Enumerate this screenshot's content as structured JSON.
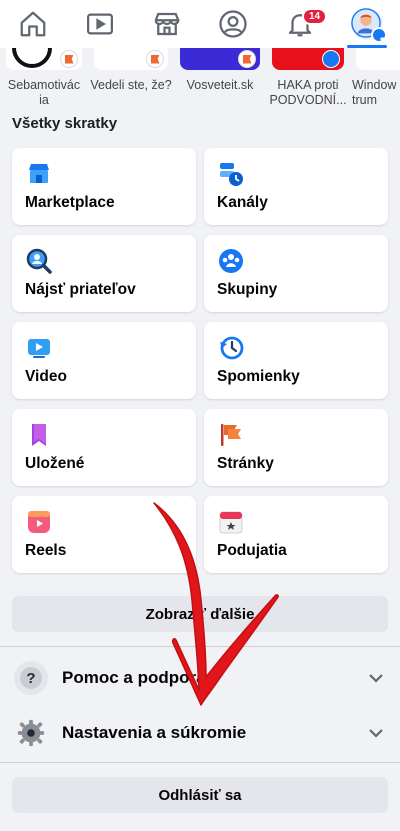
{
  "nav": {
    "items": [
      {
        "name": "home",
        "icon": "home-icon"
      },
      {
        "name": "watch",
        "icon": "video-icon"
      },
      {
        "name": "marketplace",
        "icon": "shop-icon"
      },
      {
        "name": "profile",
        "icon": "profile-icon"
      },
      {
        "name": "notifications",
        "icon": "bell-icon",
        "badge": "14"
      },
      {
        "name": "menu",
        "icon": "avatar-menu-icon",
        "active": true
      }
    ],
    "notifications_badge": "14"
  },
  "stories": [
    {
      "label": "Sebamotivác ia"
    },
    {
      "label": "Vedeli ste, že?"
    },
    {
      "label": "Vosveteit.sk"
    },
    {
      "label": "HAKA proti PODVODNÍ..."
    },
    {
      "label": "Window trum"
    }
  ],
  "shortcuts_title": "Všetky skratky",
  "shortcuts": [
    {
      "label": "Marketplace",
      "icon": "marketplace-icon"
    },
    {
      "label": "Kanály",
      "icon": "feeds-icon"
    },
    {
      "label": "Nájsť priateľov",
      "icon": "find-friends-icon"
    },
    {
      "label": "Skupiny",
      "icon": "groups-icon"
    },
    {
      "label": "Video",
      "icon": "video-icon"
    },
    {
      "label": "Spomienky",
      "icon": "memories-icon"
    },
    {
      "label": "Uložené",
      "icon": "saved-icon"
    },
    {
      "label": "Stránky",
      "icon": "pages-icon"
    },
    {
      "label": "Reels",
      "icon": "reels-icon"
    },
    {
      "label": "Podujatia",
      "icon": "events-icon"
    }
  ],
  "show_more_label": "Zobraziť ďalšie",
  "help_label": "Pomoc a podpora",
  "settings_label": "Nastavenia a súkromie",
  "logout_label": "Odhlásiť sa",
  "colors": {
    "accent": "#1877f2",
    "badge": "#e41e3f",
    "annotation_arrow": "#e0161b"
  }
}
